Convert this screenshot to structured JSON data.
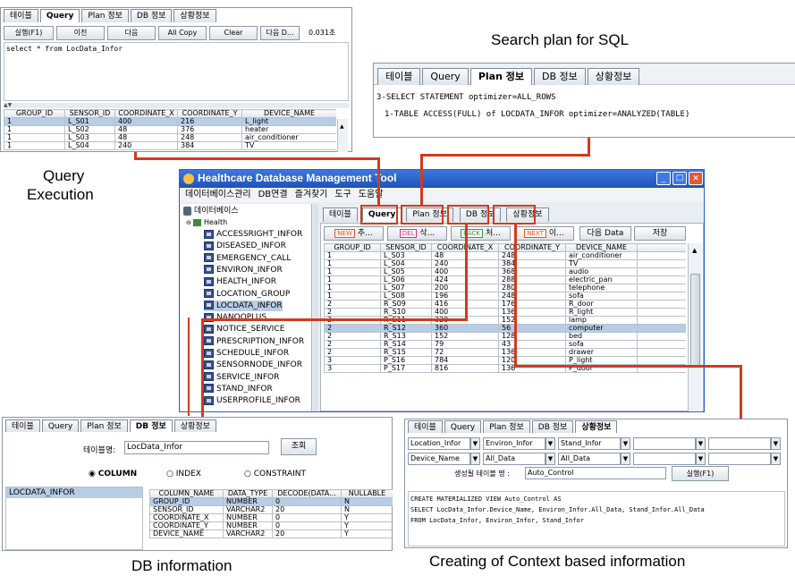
{
  "captions": {
    "search_plan": "Search plan for SQL",
    "query_exec_line1": "Query",
    "query_exec_line2": "Execution",
    "db_info": "DB information",
    "context_info": "Creating of Context based information"
  },
  "query_panel": {
    "tabs": [
      "테이블",
      "Query",
      "Plan 정보",
      "DB 정보",
      "상황정보"
    ],
    "buttons": [
      "실행(F1)",
      "이전",
      "다음",
      "All Copy",
      "Clear",
      "다음 D..."
    ],
    "elapsed": "0.031초",
    "sql": "select * from LocData_Infor",
    "columns": [
      "GROUP_ID",
      "SENSOR_ID",
      "COORDINATE_X",
      "COORDINATE_Y",
      "DEVICE_NAME"
    ],
    "rows": [
      [
        "1",
        "L_S01",
        "400",
        "216",
        "L_light"
      ],
      [
        "1",
        "L_S02",
        "48",
        "376",
        "heater"
      ],
      [
        "1",
        "L_S03",
        "48",
        "248",
        "air_conditioner"
      ],
      [
        "1",
        "L_S04",
        "240",
        "384",
        "TV"
      ]
    ]
  },
  "plan_panel": {
    "tabs": [
      "테이블",
      "Query",
      "Plan 정보",
      "DB 정보",
      "상황정보"
    ],
    "line1": "3-SELECT STATEMENT optimizer=ALL_ROWS",
    "line2": "1-TABLE ACCESS(FULL) of LOCDATA_INFOR optimizer=ANALYZED(TABLE)"
  },
  "main_window": {
    "title": "Healthcare Database Management Tool",
    "menu": [
      "데이터베이스관리",
      "DB연결",
      "즐겨찾기",
      "도구",
      "도움말"
    ],
    "tree_root": "데이터베이스",
    "tree_health": "Health",
    "tree_items": [
      "ACCESSRIGHT_INFOR",
      "DISEASED_INFOR",
      "EMERGENCY_CALL",
      "ENVIRON_INFOR",
      "HEALTH_INFOR",
      "LOCATION_GROUP",
      "LOCDATA_INFOR",
      "NANOOPLUS",
      "NOTICE_SERVICE",
      "PRESCRIPTION_INFOR",
      "SCHEDULE_INFOR",
      "SENSORNODE_INFOR",
      "SERVICE_INFOR",
      "STAND_INFOR",
      "USERPROFILE_INFOR"
    ],
    "selected_tree_item": "LOCDATA_INFOR",
    "tabs": [
      "테이블",
      "Query",
      "Plan 정보",
      "DB 정보",
      "상황정보"
    ],
    "toolbar": [
      {
        "badge": "NEW",
        "label": "추..."
      },
      {
        "badge": "DEL",
        "label": "삭..."
      },
      {
        "badge": "BACK",
        "label": "처..."
      },
      {
        "badge": "NEXT",
        "label": "이..."
      }
    ],
    "next_data": "다음 Data",
    "save": "저장",
    "columns": [
      "GROUP_ID",
      "SENSOR_ID",
      "COORDINATE_X",
      "COORDINATE_Y",
      "DEVICE_NAME"
    ],
    "rows": [
      [
        "1",
        "L_S03",
        "48",
        "248",
        "air_conditioner"
      ],
      [
        "1",
        "L_S04",
        "240",
        "384",
        "TV"
      ],
      [
        "1",
        "L_S05",
        "400",
        "368",
        "audio"
      ],
      [
        "1",
        "L_S06",
        "424",
        "288",
        "electric_pan"
      ],
      [
        "1",
        "L_S07",
        "200",
        "280",
        "telephone"
      ],
      [
        "1",
        "L_S08",
        "196",
        "248",
        "sofa"
      ],
      [
        "2",
        "R_S09",
        "416",
        "176",
        "R_door"
      ],
      [
        "2",
        "R_S10",
        "400",
        "136",
        "R_light"
      ],
      [
        "2",
        "R_S11",
        "320",
        "152",
        "lamp"
      ],
      [
        "2",
        "R_S12",
        "360",
        "56",
        "computer"
      ],
      [
        "2",
        "R_S13",
        "152",
        "128",
        "bed"
      ],
      [
        "2",
        "R_S14",
        "79",
        "43",
        "sofa"
      ],
      [
        "2",
        "R_S15",
        "72",
        "136",
        "drawer"
      ],
      [
        "3",
        "P_S16",
        "784",
        "120",
        "P_light"
      ],
      [
        "3",
        "P_S17",
        "816",
        "136",
        "P_door"
      ]
    ],
    "selected_row": 9
  },
  "db_panel": {
    "tabs": [
      "테이블",
      "Query",
      "Plan 정보",
      "DB 정보",
      "상황정보"
    ],
    "table_label": "테이블명:",
    "table_value": "LocData_Infor",
    "lookup": "조회",
    "radios": [
      "COLUMN",
      "INDEX",
      "CONSTRAINT"
    ],
    "list_item": "LOCDATA_INFOR",
    "columns": [
      "COLUMN_NAME",
      "DATA_TYPE",
      "DECODE(DATA...",
      "NULLABLE"
    ],
    "rows": [
      [
        "GROUP_ID",
        "NUMBER",
        "0",
        "N"
      ],
      [
        "SENSOR_ID",
        "VARCHAR2",
        "20",
        "N"
      ],
      [
        "COORDINATE_X",
        "NUMBER",
        "0",
        "Y"
      ],
      [
        "COORDINATE_Y",
        "NUMBER",
        "0",
        "Y"
      ],
      [
        "DEVICE_NAME",
        "VARCHAR2",
        "20",
        "Y"
      ]
    ]
  },
  "context_panel": {
    "tabs": [
      "테이블",
      "Query",
      "Plan 정보",
      "DB 정보",
      "상황정보"
    ],
    "combos_row1": [
      "Location_Infor",
      "Environ_Infor",
      "Stand_Infor",
      "",
      "",
      ""
    ],
    "combos_row2": [
      "Device_Name",
      "All_Data",
      "All_Data",
      "",
      "",
      ""
    ],
    "table_label": "생성될 테이블 명 :",
    "table_value": "Auto_Control",
    "run": "실행(F1)",
    "sql1": "CREATE MATERIALIZED VIEW Auto_Control AS",
    "sql2": "SELECT LocData_Infor.Device_Name, Environ_Infor.All_Data, Stand_Infor.All_Data",
    "sql3": "FROM LocData_Infor, Environ_Infor, Stand_Infor"
  },
  "colors": {
    "accent_red": "#d03c1a",
    "title_blue": "#2a5fc7",
    "selection": "#b8cde6"
  }
}
